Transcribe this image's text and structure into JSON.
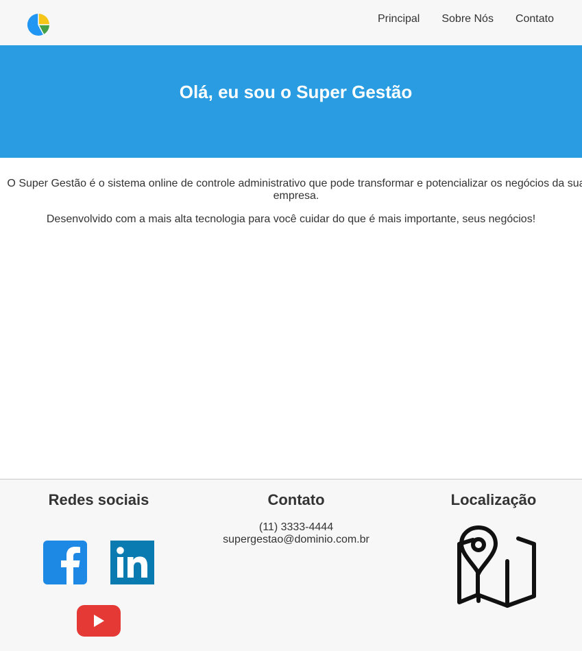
{
  "header": {
    "logo": "pie-chart-logo-icon",
    "menu": [
      {
        "label": "Principal"
      },
      {
        "label": "Sobre Nós"
      },
      {
        "label": "Contato"
      }
    ]
  },
  "banner": {
    "title": "Olá, eu sou o Super Gestão",
    "color": "#2a9de2"
  },
  "content": {
    "paragraph1": "O Super Gestão é o sistema online de controle administrativo que pode transformar e potencializar os negócios da sua empresa.",
    "paragraph2": "Desenvolvido com a mais alta tecnologia para você cuidar do que é mais importante, seus negócios!"
  },
  "footer": {
    "social": {
      "title": "Redes sociais",
      "icons": [
        "facebook-icon",
        "linkedin-icon",
        "youtube-icon"
      ]
    },
    "contact": {
      "title": "Contato",
      "phone": "(11) 3333-4444",
      "email": "supergestao@dominio.com.br"
    },
    "location": {
      "title": "Localização",
      "icon": "map-icon"
    }
  }
}
